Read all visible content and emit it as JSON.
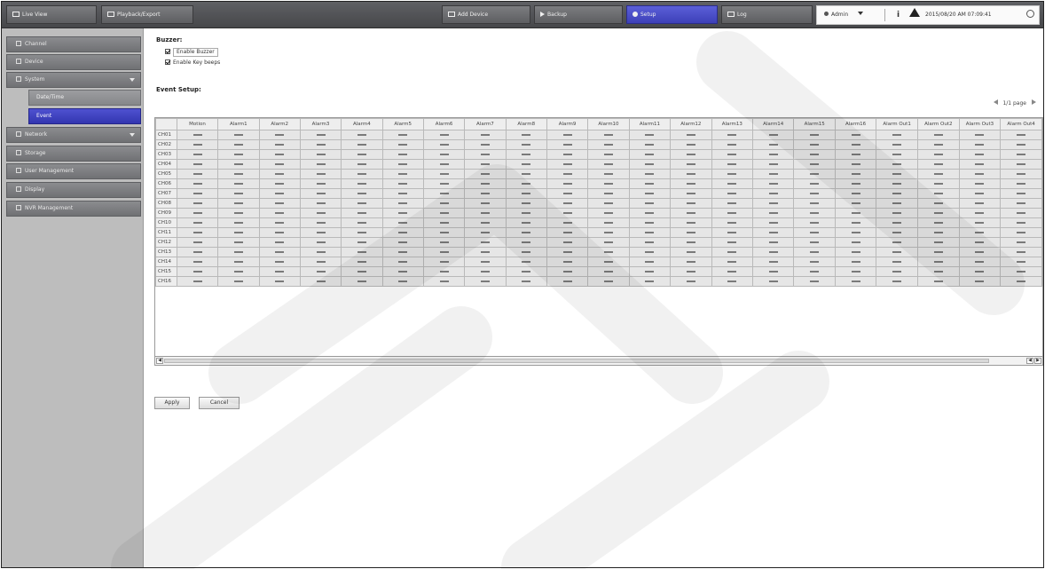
{
  "topbar": {
    "live_view": "Live View",
    "playback": "Playback/Export",
    "add_device": "Add Device",
    "backup": "Backup",
    "setup": "Setup",
    "log": "Log",
    "user": "Admin",
    "datetime": "2015/08/20 AM 07:09:41",
    "accent": "#4346c4"
  },
  "sidebar": {
    "items": [
      {
        "label": "Channel"
      },
      {
        "label": "Device"
      },
      {
        "label": "System"
      },
      {
        "label": "Network"
      },
      {
        "label": "Storage"
      },
      {
        "label": "User Management"
      },
      {
        "label": "Display"
      },
      {
        "label": "NVR Management"
      }
    ],
    "system_sub": [
      {
        "label": "Date/Time"
      },
      {
        "label": "Event"
      }
    ]
  },
  "main": {
    "buzzer_label": "Buzzer:",
    "enable_buzzer": "Enable Buzzer",
    "enable_key_beeps": "Enable Key beeps",
    "event_setup_label": "Event Setup:",
    "pager_text": "1/1 page",
    "apply": "Apply",
    "cancel": "Cancel"
  },
  "grid": {
    "columns": [
      "Motion",
      "Alarm1",
      "Alarm2",
      "Alarm3",
      "Alarm4",
      "Alarm5",
      "Alarm6",
      "Alarm7",
      "Alarm8",
      "Alarm9",
      "Alarm10",
      "Alarm11",
      "Alarm12",
      "Alarm13",
      "Alarm14",
      "Alarm15",
      "Alarm16",
      "Alarm Out1",
      "Alarm Out2",
      "Alarm Out3",
      "Alarm Out4"
    ],
    "rows": [
      "CH01",
      "CH02",
      "CH03",
      "CH04",
      "CH05",
      "CH06",
      "CH07",
      "CH08",
      "CH09",
      "CH10",
      "CH11",
      "CH12",
      "CH13",
      "CH14",
      "CH15",
      "CH16"
    ],
    "cell_value": "—"
  }
}
